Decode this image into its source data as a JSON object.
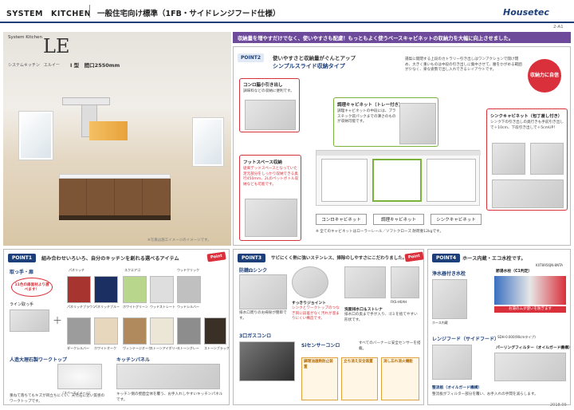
{
  "header": {
    "left": "SYSTEM　KITCHEN",
    "title": "一般住宅向け標準（1FB・サイドレンジフード仕様）",
    "brand": "Housetec",
    "page_no": "2-A1"
  },
  "product": {
    "label": "System Kitchen",
    "logo": "LE",
    "sub": "システムキッチン　エルイー",
    "size": "I 型　間口2550mm",
    "note": "※写真は施工イメージのイメージです。"
  },
  "banner": "収納量を増やすだけでなく、使いやすさも配慮！もっともよく使うベースキャビネットの収納力を大幅に向上させました。",
  "point2": {
    "tag": "POINT2",
    "head1": "使いやすさと収納量がぐんとアップ",
    "head2": "シンプルスライド収納タイプ",
    "intro": "揚梨に開閉する上段のカトラリー引き出しはワンアクションで開け閉め、大きく重いものは中段の引き出しに集中させて、腰をかがめる範囲が少なく、楽な姿勢で出し入れできるレイアウトです。",
    "badge": "収納力に自信",
    "konro": {
      "title": "コンロ脇小引き出し",
      "desc": "調味料などの収納に便利です。"
    },
    "chori": {
      "title": "調理キャビネット（トレー付き）",
      "desc": "調理キャビネットの中段には、プラスチック袋パックまでの薄さのものが収納可能です。"
    },
    "sink": {
      "title": "シンクキャビネット（包丁差し付き）",
      "desc": "シンク下の引き出しの奥行きも手前引き出しで＋10cm、下段引き出しで＋5cmUP！"
    },
    "foot": {
      "title": "フットスペース収納",
      "desc": "従来デッドスペースとなっていた足元部分をしっかり収納できる奥行450mm、2Lのペットボトル収納なども可能です。"
    },
    "labels": [
      "コンロキャビネット",
      "調理キャビネット",
      "シンクキャビネット"
    ],
    "spec": "※ 全てのキャビネットはローラーレール／ソフトクローズ 耐荷重12kgです。"
  },
  "point1": {
    "tag": "POINT1",
    "head": "組み合わせいろいろ、自分のキッチンを創れる選べるアイテム",
    "badge": "Point",
    "handle": "取っ手・扉",
    "handle_note": "11色の扉面材より選べます！",
    "line": "ライン取っ手",
    "groups": [
      "パネリッチ",
      "スクエアゴ",
      "ウッドクリック"
    ],
    "swatches": [
      "パネリッチブラウン",
      "パネリッチブルー",
      "ホワイトグリーン",
      "ウッドストレート",
      "ウッドシルバー",
      "ダークシルバー",
      "ホワイトオーク",
      "ヴィンテージオーク",
      "ストーンアイボリー",
      "ストーングレー",
      "ストーンブラック"
    ],
    "wt": "人造大理石製ワークトップ",
    "wt_sub": "（スペースイメージ）",
    "wt_desc": "重ねて落ちてもキズが目立ちにくい、天然石に近い質感のワークトップです。",
    "kp": "キッチンパネル",
    "kp_desc": "キッチン側の壁面全体を覆う、お手入れしやすいキッチンパネルです。"
  },
  "point3": {
    "tag": "POINT3",
    "head": "サビにくく熱に強いステンレス、掃除のしやすさにこだわりました。",
    "badge": "Point",
    "sink": "防錆Ωシンク",
    "sink_desc": "排水口周りのお掃除が簡単です。",
    "joint": "すっきりジョイント",
    "joint_desc": "シンクとワークトップのつなぎ目に段差がなく汚れが溜まりにくい構造です。",
    "drain": "洗面排水口＆ストレナ",
    "drain_desc": "排水口の奥まで手が入り、ゴミを捨てやすい形状です。",
    "model": "FKS-H0AH",
    "gas": "3口ガスコンロ",
    "gas_title": "Siセンサーコンロ",
    "gas_desc": "すべてのバーナーに安全センサーを搭載。",
    "gas_feat": [
      "調理油過熱防止装置",
      "立ち消え安全装置",
      "消し忘れ消火機能"
    ]
  },
  "point4": {
    "tag": "POINT4",
    "head": "ホース内蔵・エコ水栓です。",
    "model": "KXT8956JN-8NTA",
    "faucet": "浄水器付き水栓",
    "hose": "ホース内蔵",
    "eco": "節湯水栓（C1判定）",
    "eco_desc": "お湯のムダ使いを防ぎます",
    "hood": "レンジフード（サイドフード）",
    "hood_sub": "パーリングフィルター（オイルガード機構）",
    "hood_model": "SDH-0.000(90cmタイプ)",
    "eco2": "整流板（オイルガード機構）",
    "eco2_desc": "整流板がフィルター部分を覆い、お手入れの手間を減らします。"
  },
  "date": "2018.09"
}
